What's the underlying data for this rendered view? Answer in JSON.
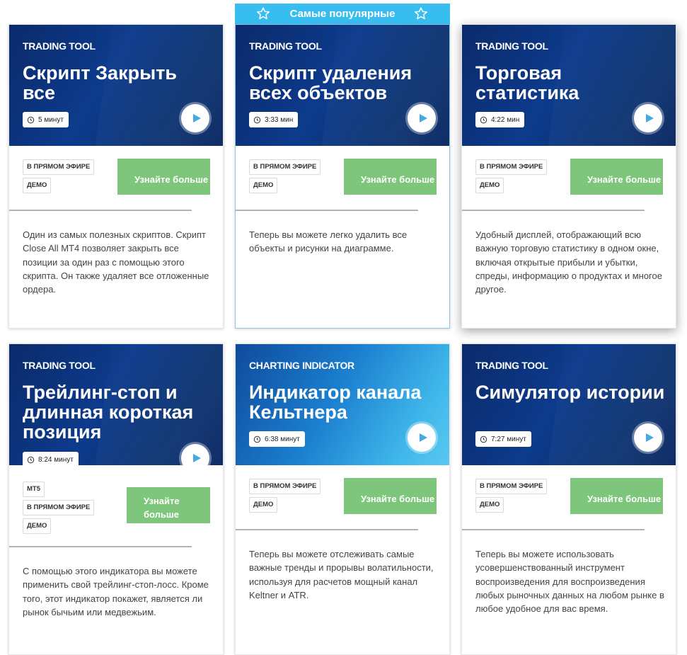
{
  "banner": {
    "label": "Самые популярные"
  },
  "cards": [
    {
      "kicker": "TRADING TOOL",
      "title": "Скрипт Закрыть все",
      "duration": "5 минут",
      "badges": [
        "В ПРЯМОМ ЭФИРЕ",
        "ДЕМО"
      ],
      "cta": "Узнайте больше",
      "description": "Один из самых полезных скриптов. Скрипт Close All MT4 позволяет закрыть все позиции за один раз с помощью этого скрипта. Он также удаляет все отложенные ордера."
    },
    {
      "kicker": "TRADING TOOL",
      "title": "Скрипт удаления всех объектов",
      "duration": "3:33 мин",
      "badges": [
        "В ПРЯМОМ ЭФИРЕ",
        "ДЕМО"
      ],
      "cta": "Узнайте больше",
      "description": "Теперь вы можете легко удалить все объекты и рисунки на диаграмме."
    },
    {
      "kicker": "TRADING TOOL",
      "title": "Торговая статистика",
      "duration": "4:22 мин",
      "badges": [
        "В ПРЯМОМ ЭФИРЕ",
        "ДЕМО"
      ],
      "cta": "Узнайте больше",
      "description": "Удобный дисплей, отображающий всю важную торговую статистику в одном окне, включая открытые прибыли и убытки, спреды, информацию о продуктах и многое другое."
    },
    {
      "kicker": "TRADING TOOL",
      "title": "Трейлинг-стоп и длинная короткая позиция",
      "duration": "8:24 минут",
      "badges": [
        "MT5",
        "В ПРЯМОМ ЭФИРЕ",
        "ДЕМО"
      ],
      "cta": "Узнайте больше",
      "description": "С помощью этого индикатора вы можете применить свой трейлинг-стоп-лосс. Кроме того, этот индикатор покажет, является ли рынок бычьим или медвежьим."
    },
    {
      "kicker": "CHARTING INDICATOR",
      "title": "Индикатор канала Кельтнера",
      "duration": "6:38 минут",
      "badges": [
        "В ПРЯМОМ ЭФИРЕ",
        "ДЕМО"
      ],
      "cta": "Узнайте больше",
      "description": "Теперь вы можете отслеживать самые важные тренды и прорывы волатильности, используя для расчетов мощный канал Keltner и ATR."
    },
    {
      "kicker": "TRADING TOOL",
      "title": "Симулятор истории",
      "duration": "7:27 минут",
      "badges": [
        "В ПРЯМОМ ЭФИРЕ",
        "ДЕМО"
      ],
      "cta": "Узнайте больше",
      "description": "Теперь вы можете использовать усовершенствованный инструмент воспроизведения для воспроизведения любых рыночных данных на любом рынке в любое удобное для вас время."
    }
  ],
  "icons": {
    "duration": "clock-icon",
    "play": "play-icon",
    "banner": "star-icon"
  },
  "colors": {
    "cta": "#7dc67b",
    "banner": "#38bdf0",
    "hero": "#0d3b8c"
  }
}
